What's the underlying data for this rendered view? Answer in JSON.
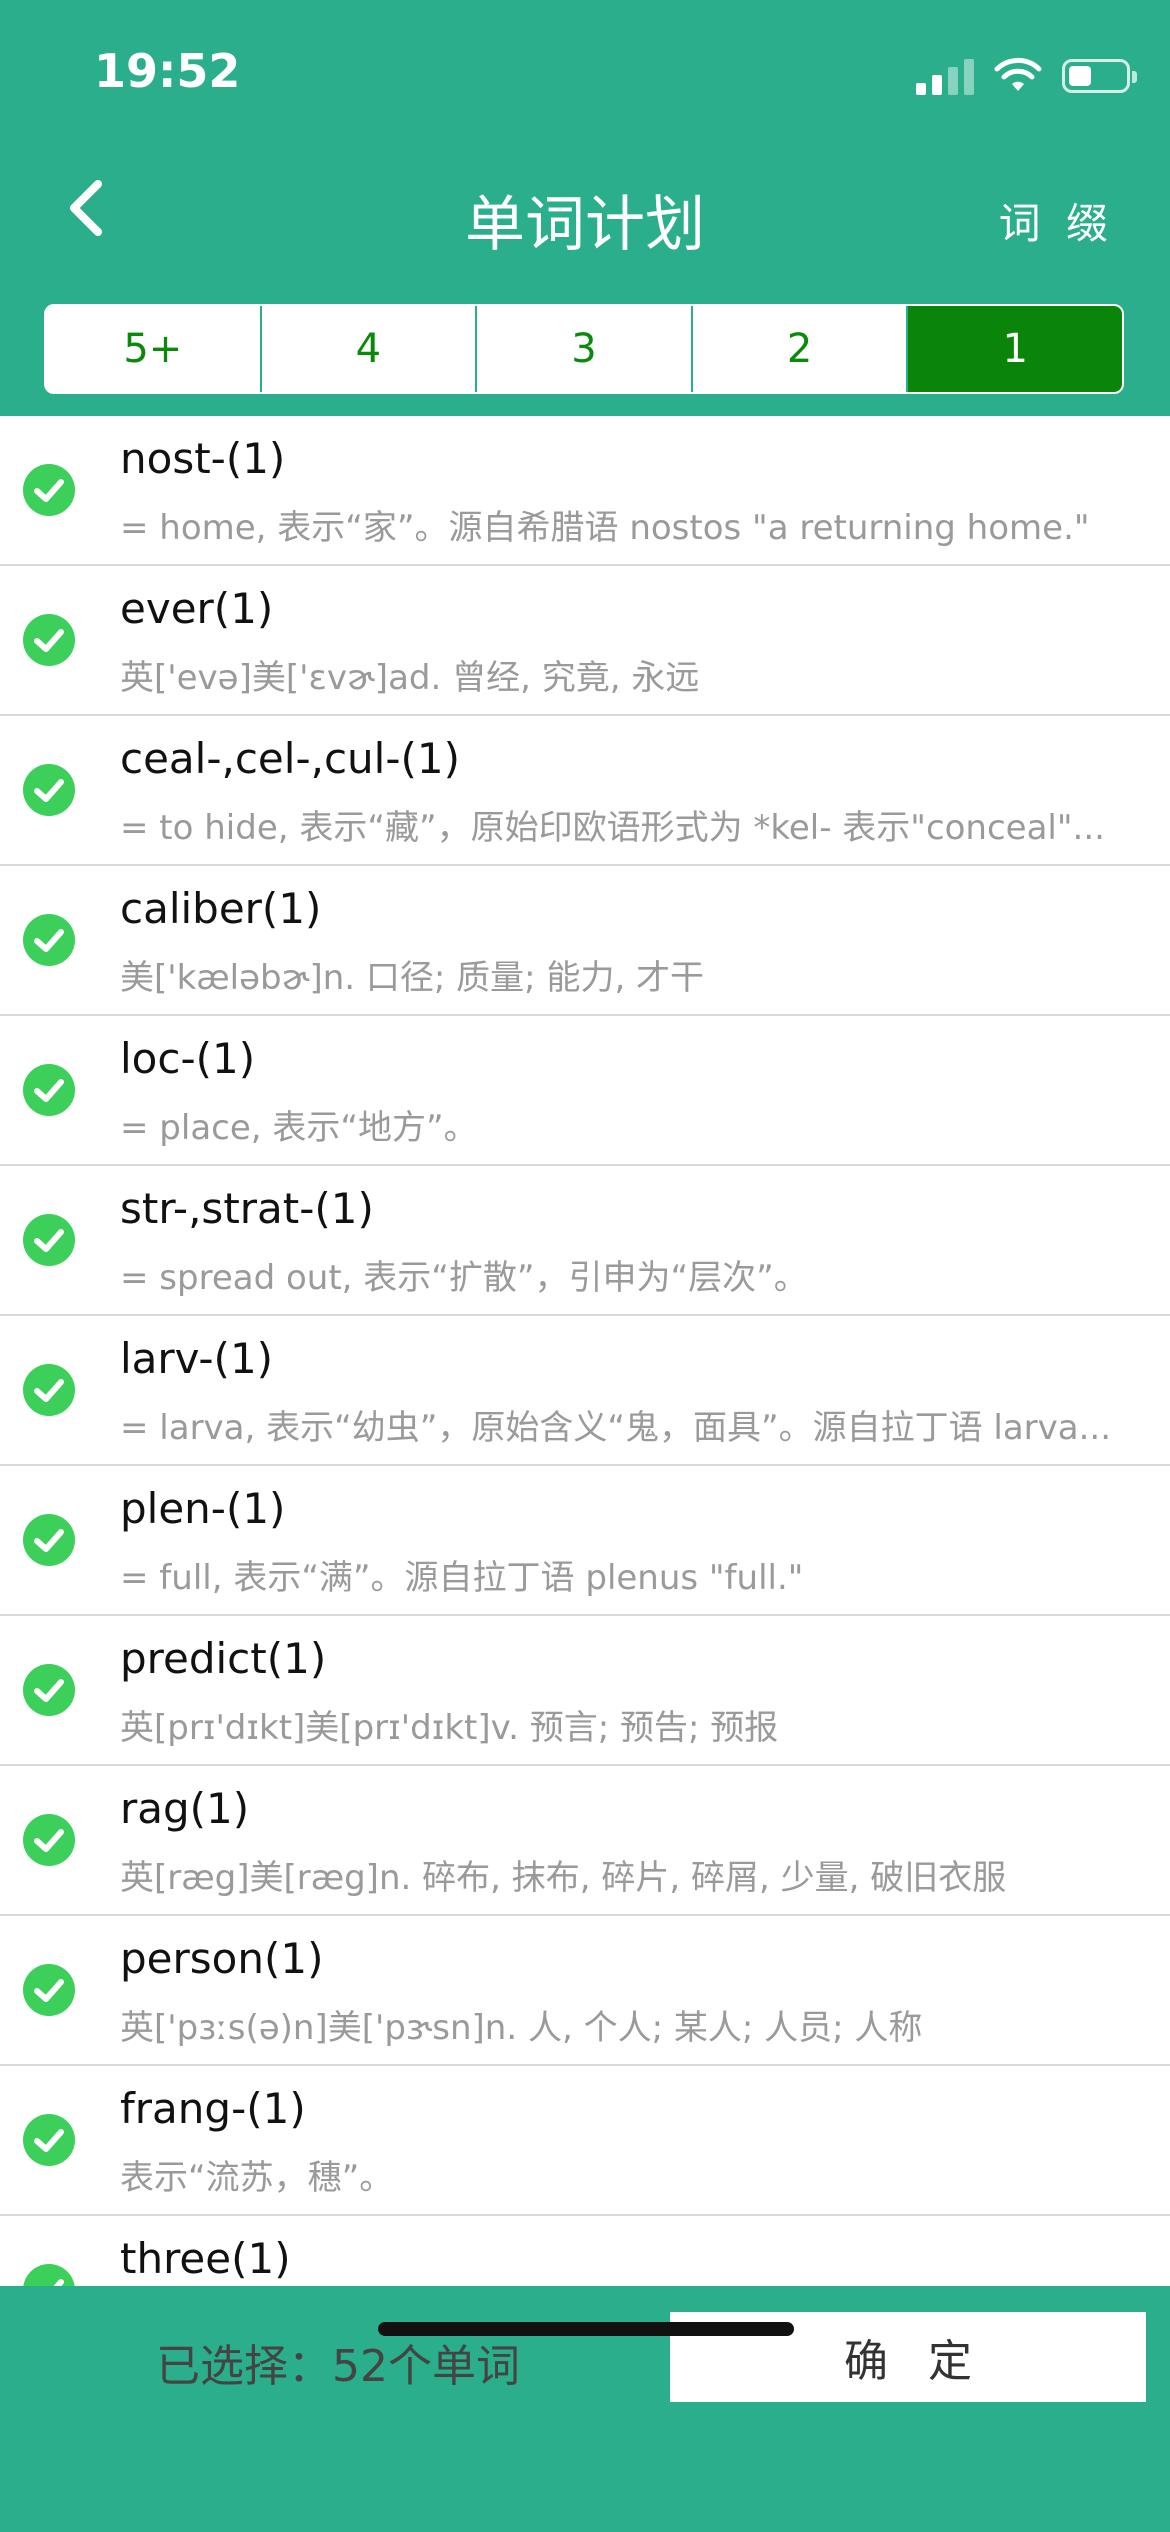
{
  "status": {
    "time": "19:52"
  },
  "header": {
    "title": "单词计划",
    "right_label": "词 缀"
  },
  "segments": [
    {
      "label": "5+",
      "active": false
    },
    {
      "label": "4",
      "active": false
    },
    {
      "label": "3",
      "active": false
    },
    {
      "label": "2",
      "active": false
    },
    {
      "label": "1",
      "active": true
    }
  ],
  "items": [
    {
      "word": "nost-(1)",
      "desc": "= home, 表示“家”。源自希腊语 nostos \"a returning home.\""
    },
    {
      "word": "ever(1)",
      "desc": "英['evə]美['ɛvɚ]ad. 曾经, 究竟, 永远"
    },
    {
      "word": "ceal-,cel-,cul-(1)",
      "desc": "= to hide, 表示“藏”，原始印欧语形式为 *kel- 表示\"conceal\"..."
    },
    {
      "word": "caliber(1)",
      "desc": "美['kæləbɚ]n. 口径; 质量; 能力, 才干"
    },
    {
      "word": "loc-(1)",
      "desc": "= place, 表示“地方”。"
    },
    {
      "word": "str-,strat-(1)",
      "desc": "= spread out, 表示“扩散”，引申为“层次”。"
    },
    {
      "word": "larv-(1)",
      "desc": "= larva, 表示“幼虫”，原始含义“鬼，面具”。源自拉丁语 larva..."
    },
    {
      "word": "plen-(1)",
      "desc": "= full, 表示“满”。源自拉丁语 plenus \"full.\""
    },
    {
      "word": "predict(1)",
      "desc": "英[prɪ'dɪkt]美[prɪ'dɪkt]v. 预言; 预告; 预报"
    },
    {
      "word": "rag(1)",
      "desc": "英[ræg]美[ræg]n. 碎布, 抹布, 碎片, 碎屑, 少量, 破旧衣服"
    },
    {
      "word": "person(1)",
      "desc": "英['pɜːs(ə)n]美['pɝsn]n. 人, 个人; 某人; 人员; 人称"
    },
    {
      "word": "frang-(1)",
      "desc": "表示“流苏，穗”。"
    },
    {
      "word": "three(1)",
      "desc": ""
    }
  ],
  "footer": {
    "selected_text": "已选择：52个单词",
    "confirm_label": "确定"
  },
  "colors": {
    "brand": "#2aae8c",
    "active_segment": "#0a850a",
    "check": "#3ccf5a"
  }
}
